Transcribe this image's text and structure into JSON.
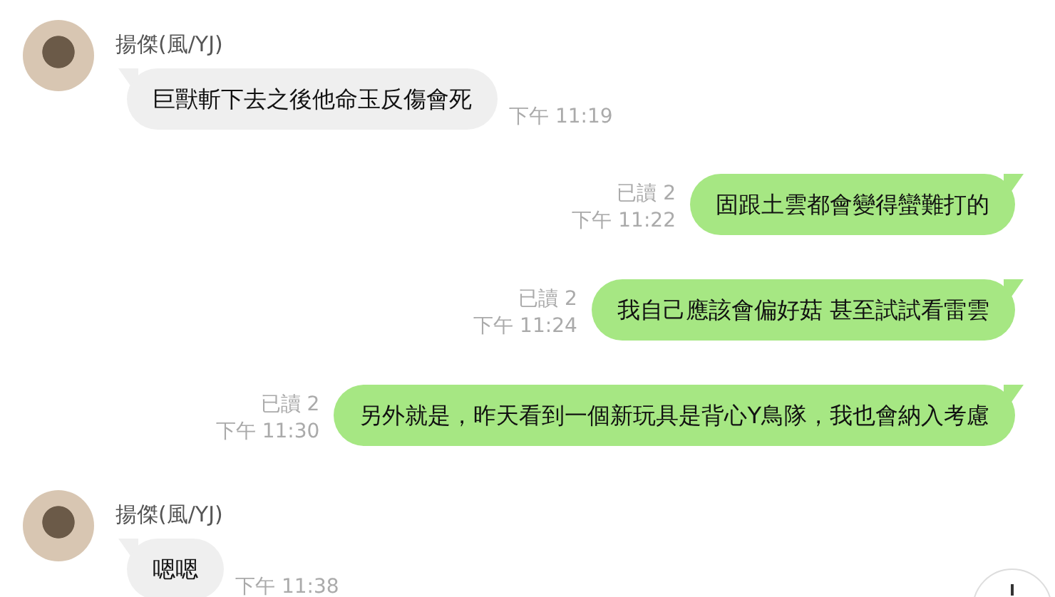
{
  "messages": [
    {
      "kind": "incoming",
      "sender": "揚傑(風/YJ)",
      "text": "巨獸斬下去之後他命玉反傷會死",
      "time": "下午 11:19"
    },
    {
      "kind": "outgoing",
      "read": "已讀 2",
      "text": "固跟土雲都會變得蠻難打的",
      "time": "下午 11:22"
    },
    {
      "kind": "outgoing",
      "read": "已讀 2",
      "text": "我自己應該會偏好菇 甚至試試看雷雲",
      "time": "下午 11:24"
    },
    {
      "kind": "outgoing",
      "read": "已讀 2",
      "text": "另外就是，昨天看到一個新玩具是背心Y鳥隊，我也會納入考慮",
      "time": "下午 11:30"
    },
    {
      "kind": "incoming",
      "sender": "揚傑(風/YJ)",
      "text": "嗯嗯",
      "time": "下午 11:38"
    }
  ]
}
